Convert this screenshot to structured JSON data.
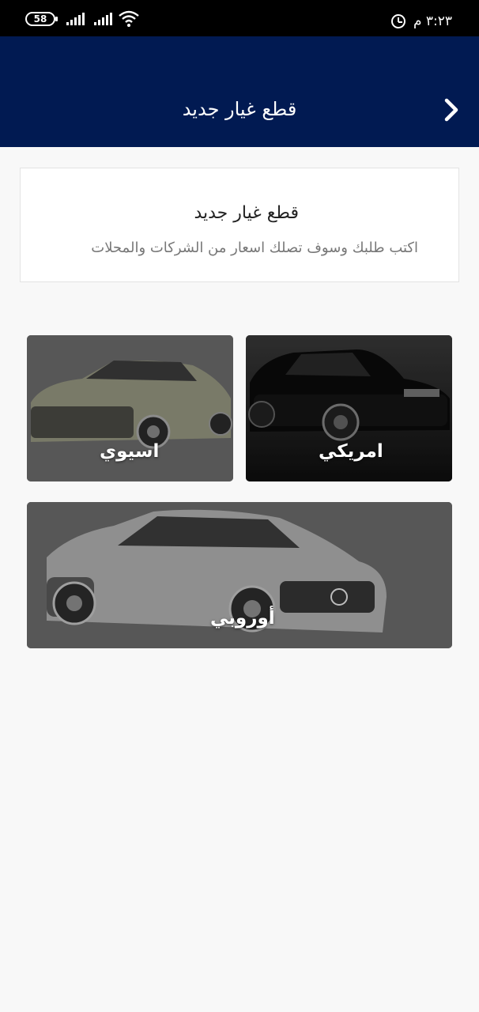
{
  "status_bar": {
    "battery": "58",
    "time": "٣:٢٣ م"
  },
  "header": {
    "title": "قطع غيار جديد",
    "back_icon": "chevron-right-icon"
  },
  "info_card": {
    "title": "قطع غيار جديد",
    "subtitle": "اكتب طلبك وسوف تصلك اسعار من الشركات والمحلات"
  },
  "categories": [
    {
      "label": "امريكي"
    },
    {
      "label": "اسيوي"
    },
    {
      "label": "أوروبي"
    }
  ],
  "colors": {
    "app_bar": "#011a52",
    "background": "#f8f8f8"
  }
}
